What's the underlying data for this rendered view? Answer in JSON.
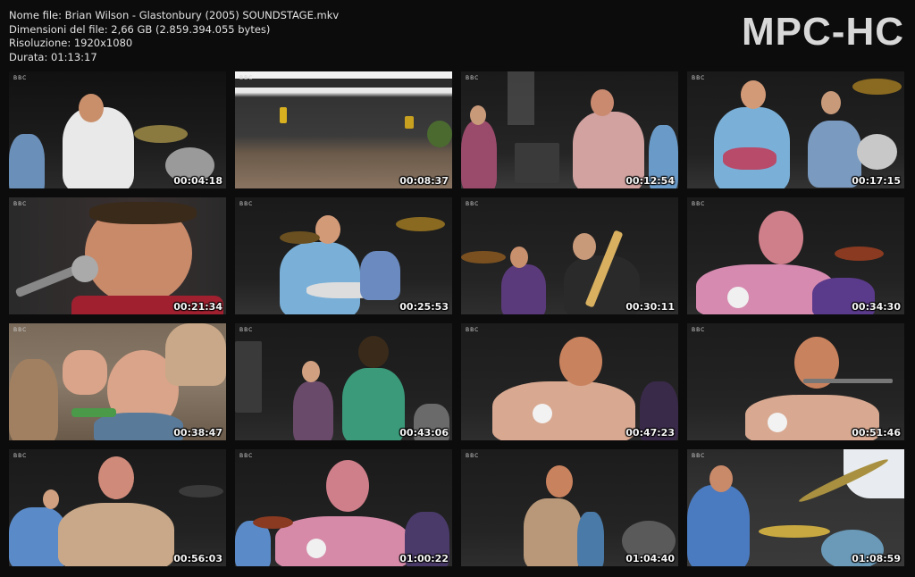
{
  "info": {
    "file_name": "Nome file: Brian Wilson - Glastonbury (2005) SOUNDSTAGE.mkv",
    "file_size": "Dimensioni del file: 2,66 GB (2.859.394.055 bytes)",
    "resolution": "Risoluzione: 1920x1080",
    "duration": "Durata: 01:13:17"
  },
  "logo": "MPC-HC",
  "thumbnails": [
    {
      "time": "00:04:18",
      "scene": "guitarist-white-shirt"
    },
    {
      "time": "00:08:37",
      "scene": "crowd-pyramid-stage"
    },
    {
      "time": "00:12:54",
      "scene": "band-vocals-keyboard"
    },
    {
      "time": "00:17:15",
      "scene": "guitarist-blue-shirt"
    },
    {
      "time": "00:21:34",
      "scene": "singer-closeup-microphone"
    },
    {
      "time": "00:25:53",
      "scene": "guitarist-blue-shirt-drums"
    },
    {
      "time": "00:30:11",
      "scene": "guitarist-sunglasses"
    },
    {
      "time": "00:34:30",
      "scene": "singer-pink-shirt"
    },
    {
      "time": "00:38:47",
      "scene": "crowd-fan-hand"
    },
    {
      "time": "00:43:06",
      "scene": "backing-vocalists"
    },
    {
      "time": "00:47:23",
      "scene": "singer-keyboard-gesture"
    },
    {
      "time": "00:51:46",
      "scene": "singer-pink-shirt-closeup"
    },
    {
      "time": "00:56:03",
      "scene": "singer-band-wide"
    },
    {
      "time": "01:00:22",
      "scene": "singer-pink-shirt-drums"
    },
    {
      "time": "01:04:40",
      "scene": "singer-bass-side"
    },
    {
      "time": "01:08:59",
      "scene": "drummer-cymbals-sky"
    }
  ]
}
